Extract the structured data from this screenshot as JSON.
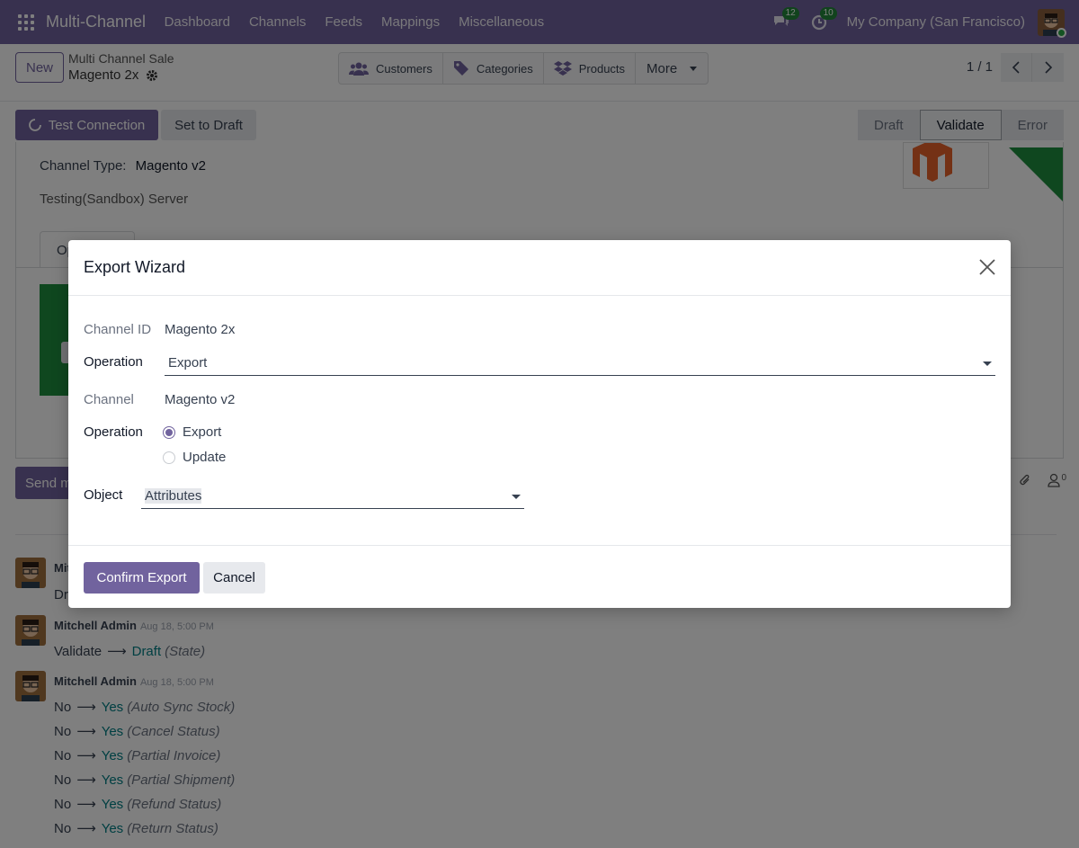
{
  "navbar": {
    "app_name": "Multi-Channel",
    "menu": [
      "Dashboard",
      "Channels",
      "Feeds",
      "Mappings",
      "Miscellaneous"
    ],
    "messages_count": "12",
    "activities_count": "10",
    "company": "My Company (San Francisco)"
  },
  "control_panel": {
    "new_label": "New",
    "breadcrumb_parent": "Multi Channel Sale",
    "breadcrumb_current": "Magento 2x",
    "stat_buttons": [
      "Customers",
      "Categories",
      "Products"
    ],
    "more_label": "More",
    "pager": "1 / 1"
  },
  "actions": {
    "test_connection": "Test Connection",
    "set_to_draft": "Set to Draft"
  },
  "statusbar": {
    "stages": [
      "Draft",
      "Validate",
      "Error"
    ],
    "active": "Validate"
  },
  "sheet": {
    "channel_type_label": "Channel Type:",
    "channel_type_value": "Magento v2",
    "environment": "Testing(Sandbox) Server",
    "tab_label": "Op"
  },
  "chatter": {
    "send_label": "Send message",
    "followers_count": "0",
    "messages": [
      {
        "author": "Mitchell Admin",
        "date": "",
        "lines": [
          {
            "text": "Dr"
          }
        ]
      },
      {
        "author": "Mitchell Admin",
        "date": "Aug 18, 5:00 PM",
        "lines": [
          {
            "old": "Validate",
            "new": "Draft",
            "field": "(State)"
          }
        ]
      },
      {
        "author": "Mitchell Admin",
        "date": "Aug 18, 5:00 PM",
        "lines": [
          {
            "old": "No",
            "new": "Yes",
            "field": "(Auto Sync Stock)"
          },
          {
            "old": "No",
            "new": "Yes",
            "field": "(Cancel Status)"
          },
          {
            "old": "No",
            "new": "Yes",
            "field": "(Partial Invoice)"
          },
          {
            "old": "No",
            "new": "Yes",
            "field": "(Partial Shipment)"
          },
          {
            "old": "No",
            "new": "Yes",
            "field": "(Refund Status)"
          },
          {
            "old": "No",
            "new": "Yes",
            "field": "(Return Status)"
          }
        ]
      }
    ]
  },
  "dialog": {
    "title": "Export Wizard",
    "channel_id_label": "Channel ID",
    "channel_id_value": "Magento 2x",
    "operation_label": "Operation",
    "operation_select_value": "Export",
    "channel_label": "Channel",
    "channel_value": "Magento v2",
    "operation_radio_label": "Operation",
    "radio_options": [
      "Export",
      "Update"
    ],
    "radio_selected": "Export",
    "object_label": "Object",
    "object_value": "Attributes",
    "confirm_label": "Confirm Export",
    "cancel_label": "Cancel"
  },
  "colors": {
    "brand": "#71639e",
    "success": "#1e8e3e",
    "link": "#017e84"
  }
}
